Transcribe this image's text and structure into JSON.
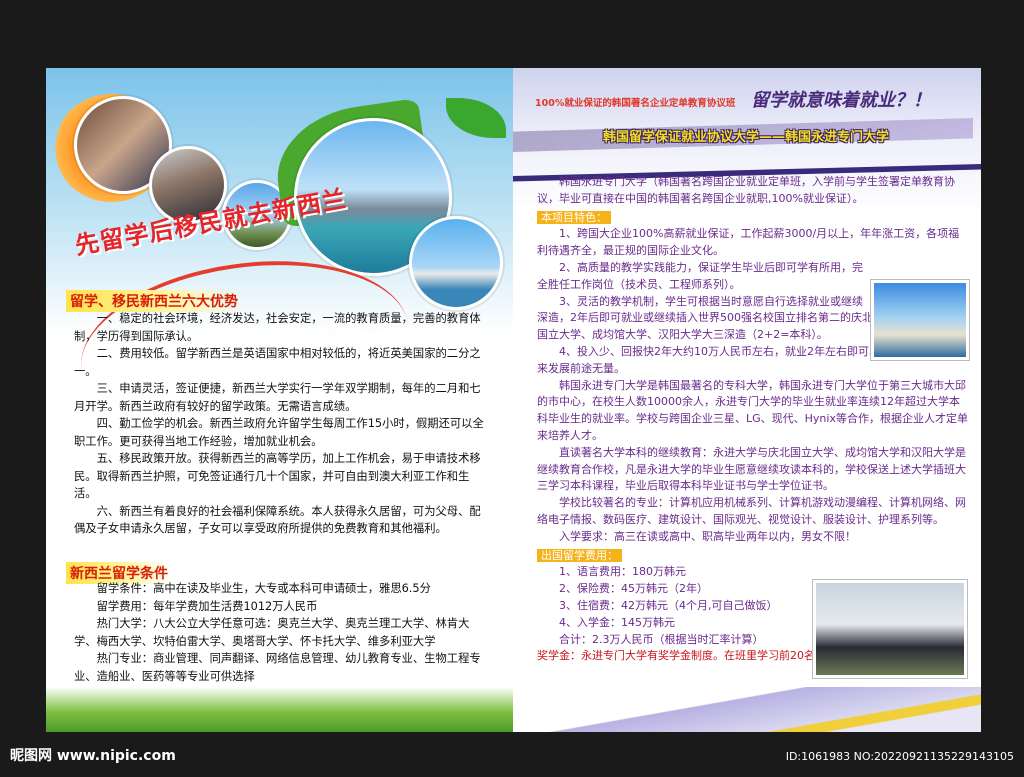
{
  "left": {
    "headline": "先留学后移民就去新西兰",
    "section1_title": "留学、移民新西兰六大优势",
    "section1_paragraphs": [
      "一、稳定的社会环境，经济发达，社会安定，一流的教育质量，完善的教育体制，学历得到国际承认。",
      "二、费用较低。留学新西兰是英语国家中相对较低的，将近英美国家的二分之一。",
      "三、申请灵活，签证便捷，新西兰大学实行一学年双学期制，每年的二月和七月开学。新西兰政府有较好的留学政策。无需语言成绩。",
      "四、勤工俭学的机会。新西兰政府允许留学生每周工作15小时，假期还可以全职工作。更可获得当地工作经验，增加就业机会。",
      "五、移民政策开放。获得新西兰的高等学历，加上工作机会，易于申请技术移民。取得新西兰护照，可免签证通行几十个国家，并可自由到澳大利亚工作和生活。",
      "六、新西兰有着良好的社会福利保障系统。本人获得永久居留，可为父母、配偶及子女申请永久居留，子女可以享受政府所提供的免费教育和其他福利。"
    ],
    "section2_title": "新西兰留学条件",
    "section2_paragraphs": [
      "留学条件：高中在读及毕业生，大专或本科可申请硕士，雅思6.5分",
      "留学费用：每年学费加生活费1012万人民币",
      "热门大学：八大公立大学任意可选：奥克兰大学、奥克兰理工大学、林肯大学、梅西大学、坎特伯雷大学、奥塔哥大学、怀卡托大学、维多利亚大学",
      "热门专业：商业管理、同声翻译、网络信息管理、幼儿教育专业、生物工程专业、造船业、医药等等专业可供选择"
    ]
  },
  "right": {
    "banner_small": "100%就业保证的韩国著名企业定单教育协议班",
    "banner_big": "留学就意味着就业？！",
    "title": "韩国留学保证就业协议大学——韩国永进专门大学",
    "intro": "韩国永进专门大学（韩国著名跨国企业就业定单班，入学前与学生签署定单教育协议，毕业可直接在中国的韩国著名跨国企业就职,100%就业保证）。",
    "features_title": "本项目特色：",
    "features": [
      "1、跨国大企业100%高薪就业保证，工作起薪3000/月以上，年年涨工资，各项福利待遇齐全，最正规的国际企业文化。",
      "2、高质量的教学实践能力，保证学生毕业后即可学有所用，完全胜任工作岗位（技术员、工程师系列）。",
      "3、灵活的教学机制，学生可根据当时意愿自行选择就业或继续深造，2年后即可就业或继续插入世界500强名校国立排名第二的庆北国立大学、成均馆大学、汉阳大学大三深造（2+2=本科）。",
      "4、投入少、回报快2年大约10万人民币左右，就业2年左右即可收回成本，孩子的未来发展前途无量。"
    ],
    "body_paragraphs": [
      "韩国永进专门大学是韩国最著名的专科大学，韩国永进专门大学位于第三大城市大邱的市中心，在校生人数10000余人，永进专门大学的毕业生就业率连续12年超过大学本科毕业生的就业率。学校与跨国企业三星、LG、现代、Hynix等合作，根据企业人才定单来培养人才。",
      "直读著名大学本科的继续教育：永进大学与庆北国立大学、成均馆大学和汉阳大学是继续教育合作校，凡是永进大学的毕业生愿意继续攻读本科的，学校保送上述大学插班大三学习本科课程，毕业后取得本科毕业证书与学士学位证书。",
      "学校比较著名的专业：计算机应用机械系列、计算机游戏动漫编程、计算机网络、网络电子情报、数码医疗、建筑设计、国际观光、视觉设计、服装设计、护理系列等。",
      "入学要求：高三在读或高中、职高毕业两年以内，男女不限！"
    ],
    "fees_title": "出国留学费用：",
    "fees": [
      "1、语言费用：180万韩元",
      "2、保险费：45万韩元（2年）",
      "3、住宿费：42万韩元（4个月,可自己做饭）",
      "4、入学金：145万韩元",
      "合计：2.3万人民币（根据当时汇率计算）"
    ],
    "scholarship": "奖学金：永进专门大学有奖学金制度。在班里学习前20名的学生可减免50%的学费。"
  },
  "watermark": {
    "logo": "昵图网 www.nipic.com",
    "id": "ID:1061983 NO:20220921135229143105"
  },
  "colors": {
    "title_red": "#d81e06",
    "banner_purple": "#4a2a7a",
    "accent_orange": "#f6b21a"
  }
}
